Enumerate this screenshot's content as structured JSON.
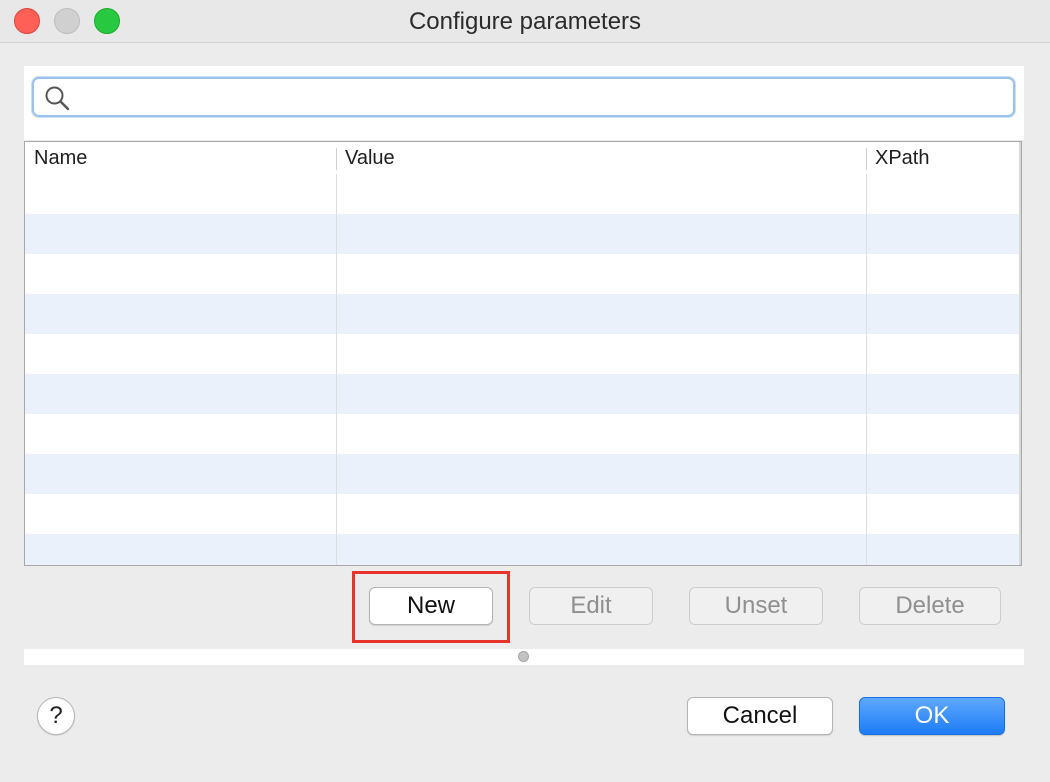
{
  "window": {
    "title": "Configure parameters"
  },
  "search": {
    "placeholder": "",
    "value": ""
  },
  "table": {
    "columns": [
      "Name",
      "Value",
      "XPath"
    ],
    "row_count_visible": 10
  },
  "actions": {
    "new_label": "New",
    "edit_label": "Edit",
    "unset_label": "Unset",
    "delete_label": "Delete"
  },
  "footer": {
    "help_label": "?",
    "cancel_label": "Cancel",
    "ok_label": "OK"
  },
  "colors": {
    "accent": "#1c7cf5",
    "highlight": "#e8322c",
    "row_alt": "#eaf1fb"
  }
}
